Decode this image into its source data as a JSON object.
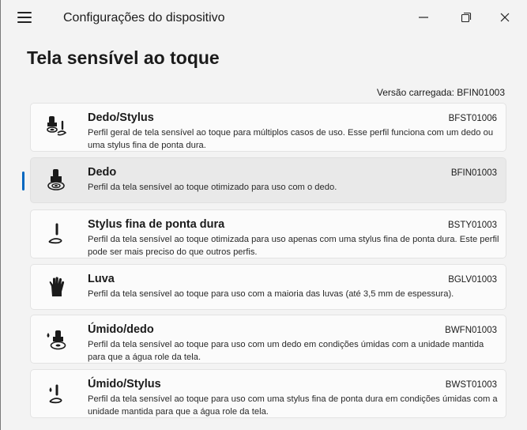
{
  "window": {
    "app_title": "Configurações do dispositivo",
    "menu_icon": "hamburger-icon",
    "minimize_icon": "minimize-icon",
    "maximize_icon": "restore-icon",
    "close_icon": "close-icon"
  },
  "page": {
    "title": "Tela sensível ao toque",
    "version_text": "Versão carregada: BFIN01003"
  },
  "profiles": [
    {
      "name": "Dedo/Stylus",
      "code": "BFST01006",
      "description": "Perfil geral de tela sensível ao toque para múltiplos casos de uso. Esse perfil funciona com um dedo ou uma stylus fina de ponta dura.",
      "icon": "finger-stylus-icon",
      "selected": false
    },
    {
      "name": "Dedo",
      "code": "BFIN01003",
      "description": "Perfil da tela sensível ao toque otimizado para uso com o dedo.",
      "icon": "finger-touch-icon",
      "selected": true
    },
    {
      "name": "Stylus fina de ponta dura",
      "code": "BSTY01003",
      "description": "Perfil da tela sensível ao toque otimizada para uso apenas com uma stylus fina de ponta dura. Este perfil pode ser mais preciso do que outros perfis.",
      "icon": "stylus-icon",
      "selected": false
    },
    {
      "name": "Luva",
      "code": "BGLV01003",
      "description": "Perfil da tela sensível ao toque para uso com a maioria das luvas (até 3,5 mm de espessura).",
      "icon": "glove-icon",
      "selected": false
    },
    {
      "name": "Úmido/dedo",
      "code": "BWFN01003",
      "description": "Perfil da tela sensível ao toque para uso com um dedo em condições úmidas com a unidade mantida para que a água role da tela.",
      "icon": "wet-finger-icon",
      "selected": false
    },
    {
      "name": "Úmido/Stylus",
      "code": "BWST01003",
      "description": "Perfil da tela sensível ao toque para uso com uma stylus fina de ponta dura em condições úmidas com a unidade mantida para que a água role da tela.",
      "icon": "wet-stylus-icon",
      "selected": false
    }
  ],
  "colors": {
    "accent": "#0067c0",
    "background": "#f3f3f3",
    "card": "#fbfbfb",
    "card_selected": "#e9e9e9"
  }
}
